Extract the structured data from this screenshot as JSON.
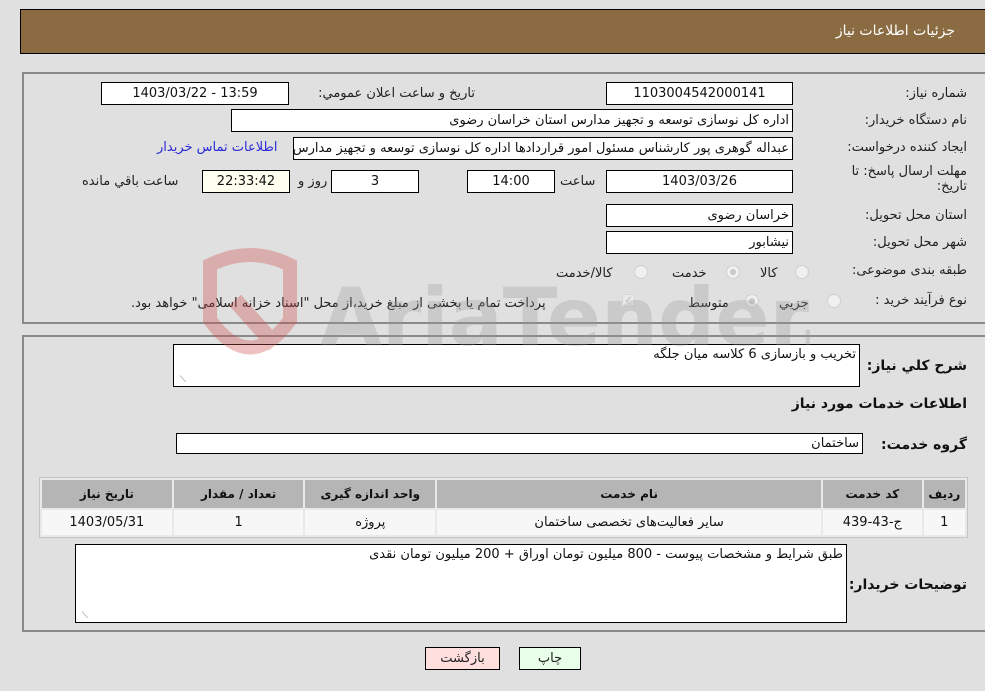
{
  "header": {
    "title": "جزئیات اطلاعات نیاز"
  },
  "details": {
    "need_number_label": "شماره نیاز:",
    "need_number": "1103004542000141",
    "announce_label": "تاريخ و ساعت اعلان عمومي:",
    "announce_value": "1403/03/22 - 13:59",
    "buyer_org_label": "نام دستگاه خريدار:",
    "buyer_org": "اداره کل نوسازی  توسعه و تجهیز مدارس استان خراسان رضوی",
    "creator_label": "ايجاد کننده درخواست:",
    "creator": "عبداله گوهری پور کارشناس مسئول امور قراردادها  اداره کل نوسازی  توسعه و تجهیز مدارس استان خراسان رضوی",
    "contact_link": "اطلاعات تماس خريدار",
    "deadline_label_line1": "مهلت ارسال پاسخ: تا",
    "deadline_label_line2": "تاريخ:",
    "deadline_date": "1403/03/26",
    "time_label": "ساعت",
    "deadline_time": "14:00",
    "days_value": "3",
    "days_label": "روز و",
    "remaining_time": "22:33:42",
    "remaining_label": "ساعت باقي مانده",
    "province_label": "استان محل تحويل:",
    "province": "خراسان رضوی",
    "city_label": "شهر محل تحويل:",
    "city": "نیشابور",
    "category_label": "طبقه بندی موضوعی:",
    "category_options": [
      {
        "label": "کالا",
        "checked": false
      },
      {
        "label": "خدمت",
        "checked": true
      },
      {
        "label": "کالا/خدمت",
        "checked": false
      }
    ],
    "process_label": "نوع فرآیند خرید :",
    "process_options": [
      {
        "label": "جزيي",
        "checked": false
      },
      {
        "label": "متوسط",
        "checked": true
      }
    ],
    "treasury_note": "پرداخت تمام يا بخشی از مبلغ خريد،از محل \"اسناد خزانه اسلامی\" خواهد بود.",
    "treasury_checked": true
  },
  "services": {
    "summary_label": "شرح کلي نياز:",
    "summary": "تخریب و بازسازی 6 کلاسه میان جلگه",
    "section_title": "اطلاعات خدمات مورد نياز",
    "group_label": "گروه خدمت:",
    "group": "ساختمان",
    "table": {
      "headers": [
        "رديف",
        "کد خدمت",
        "نام خدمت",
        "واحد اندازه گيری",
        "تعداد / مقدار",
        "تاريخ نياز"
      ],
      "rows": [
        [
          "1",
          "ج-43-439",
          "سایر فعالیت‌های تخصصی ساختمان",
          "پروژه",
          "1",
          "1403/05/31"
        ]
      ]
    },
    "buyer_notes_label": "توضيحات خريدار:",
    "buyer_notes": "طبق شرایط و مشخصات پیوست - 800 میلیون تومان اوراق + 200 میلیون تومان نقدی"
  },
  "buttons": {
    "print": "چاپ",
    "back": "بازگشت"
  },
  "watermark": {
    "text": "AriaTender.neT"
  }
}
